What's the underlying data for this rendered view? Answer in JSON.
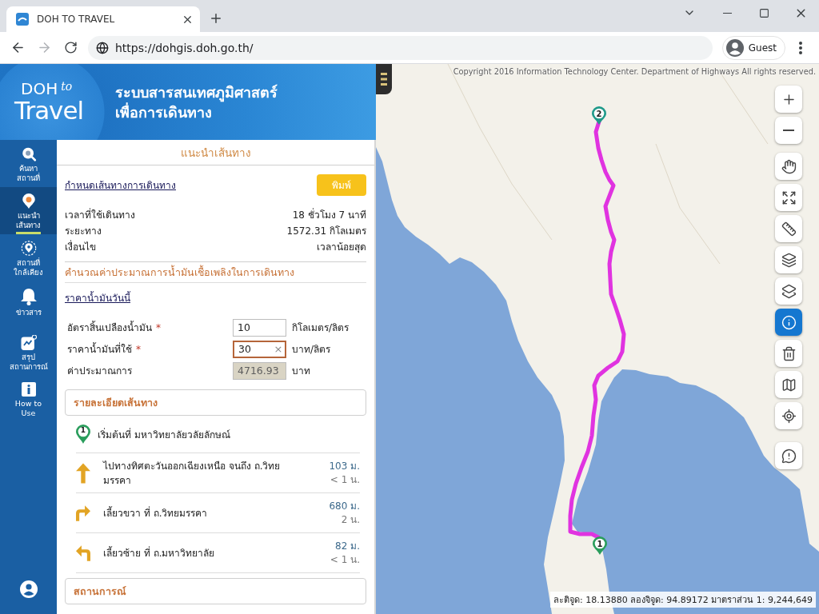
{
  "browser": {
    "tab_title": "DOH TO TRAVEL",
    "url": "https://dohgis.doh.go.th/",
    "profile": "Guest"
  },
  "header": {
    "logo": {
      "top": "DOH",
      "small": "to",
      "bottom": "Travel"
    },
    "title_lines": [
      "ระบบสารสนเทศภูมิศาสตร์",
      "เพื่อการเดินทาง"
    ]
  },
  "sidebar": {
    "items": [
      {
        "kind": "search",
        "lines": [
          "ค้นหา",
          "สถานที่"
        ],
        "selected": false
      },
      {
        "kind": "route",
        "lines": [
          "แนะนำ",
          "เส้นทาง"
        ],
        "selected": true
      },
      {
        "kind": "nearby",
        "lines": [
          "สถานที่",
          "ใกล้เคียง"
        ],
        "selected": false
      },
      {
        "kind": "news",
        "lines": [
          "ข่าวสาร"
        ],
        "selected": false
      },
      {
        "kind": "summary",
        "lines": [
          "สรุป",
          "สถานการณ์"
        ],
        "selected": false
      },
      {
        "kind": "help",
        "lines": [
          "How to",
          "Use"
        ],
        "selected": false
      }
    ]
  },
  "panel": {
    "title": "แนะนำเส้นทาง",
    "route_link": "กำหนดเส้นทางการเดินทาง",
    "print_button": "พิมพ์",
    "summary": [
      {
        "label": "เวลาที่ใช้เดินทาง",
        "value": "18 ชั่วโมง 7 นาที"
      },
      {
        "label": "ระยะทาง",
        "value": "1572.31 กิโลเมตร"
      },
      {
        "label": "เงื่อนไข",
        "value": "เวลาน้อยสุด"
      }
    ],
    "fuel": {
      "title": "คำนวณค่าประมาณการน้ำมันเชื้อเพลิงในการเดินทาง",
      "price_link": "ราคาน้ำมันวันนี้",
      "fields": [
        {
          "label": "อัตราสิ้นเปลืองน้ำมัน",
          "required_mark": "*",
          "value": "10",
          "unit": "กิโลเมตร/ลิตร",
          "focused": false,
          "disabled": false
        },
        {
          "label": "ราคาน้ำมันที่ใช้",
          "required_mark": "*",
          "value": "30",
          "clear": "×",
          "unit": "บาท/ลิตร",
          "focused": true,
          "disabled": false
        },
        {
          "label": "ค่าประมาณการ",
          "value": "4716.93",
          "unit": "บาท",
          "focused": false,
          "disabled": true
        }
      ]
    },
    "details": {
      "title": "รายละเอียดเส้นทาง",
      "steps": [
        {
          "kind": "start",
          "marker": "1",
          "text": "เริ่มต้นที่ มหาวิทยาลัยวลัยลักษณ์"
        },
        {
          "kind": "straight",
          "text": "ไปทางทิศตะวันออกเฉียงเหนือ จนถึง ถ.วิทยมรรคา",
          "distance": "103 ม.",
          "time": "< 1 น."
        },
        {
          "kind": "right",
          "text": "เลี้ยวขวา ที่ ถ.วิทยมรรคา",
          "distance": "680 ม.",
          "time": "2 น."
        },
        {
          "kind": "left",
          "text": "เลี้ยวซ้าย ที่ ถ.มหาวิทยาลัย",
          "distance": "82 ม.",
          "time": "< 1 น."
        }
      ]
    },
    "situation": {
      "title": "สถานการณ์"
    }
  },
  "map": {
    "copyright": "Copyright 2016 Information Technology Center. Department of Highways All rights reserved.",
    "control_groups": [
      [
        {
          "kind": "zoom-in",
          "selected": false
        },
        {
          "kind": "zoom-out",
          "selected": false
        }
      ],
      [
        {
          "kind": "pan",
          "selected": false
        },
        {
          "kind": "fullscreen",
          "selected": false
        },
        {
          "kind": "measure",
          "selected": false
        },
        {
          "kind": "layers",
          "selected": false
        },
        {
          "kind": "add-layer",
          "selected": false
        },
        {
          "kind": "info",
          "selected": true
        },
        {
          "kind": "delete",
          "selected": false
        },
        {
          "kind": "basemap",
          "selected": false
        },
        {
          "kind": "locate",
          "selected": false
        }
      ],
      [
        {
          "kind": "feedback",
          "selected": false
        }
      ]
    ],
    "markers": [
      {
        "kind": "end",
        "label": "2"
      },
      {
        "kind": "start",
        "label": "1"
      }
    ],
    "status": "ละติจูด: 18.13880 ลองจิจูด: 94.89172 มาตราส่วน 1: 9,244,649"
  }
}
